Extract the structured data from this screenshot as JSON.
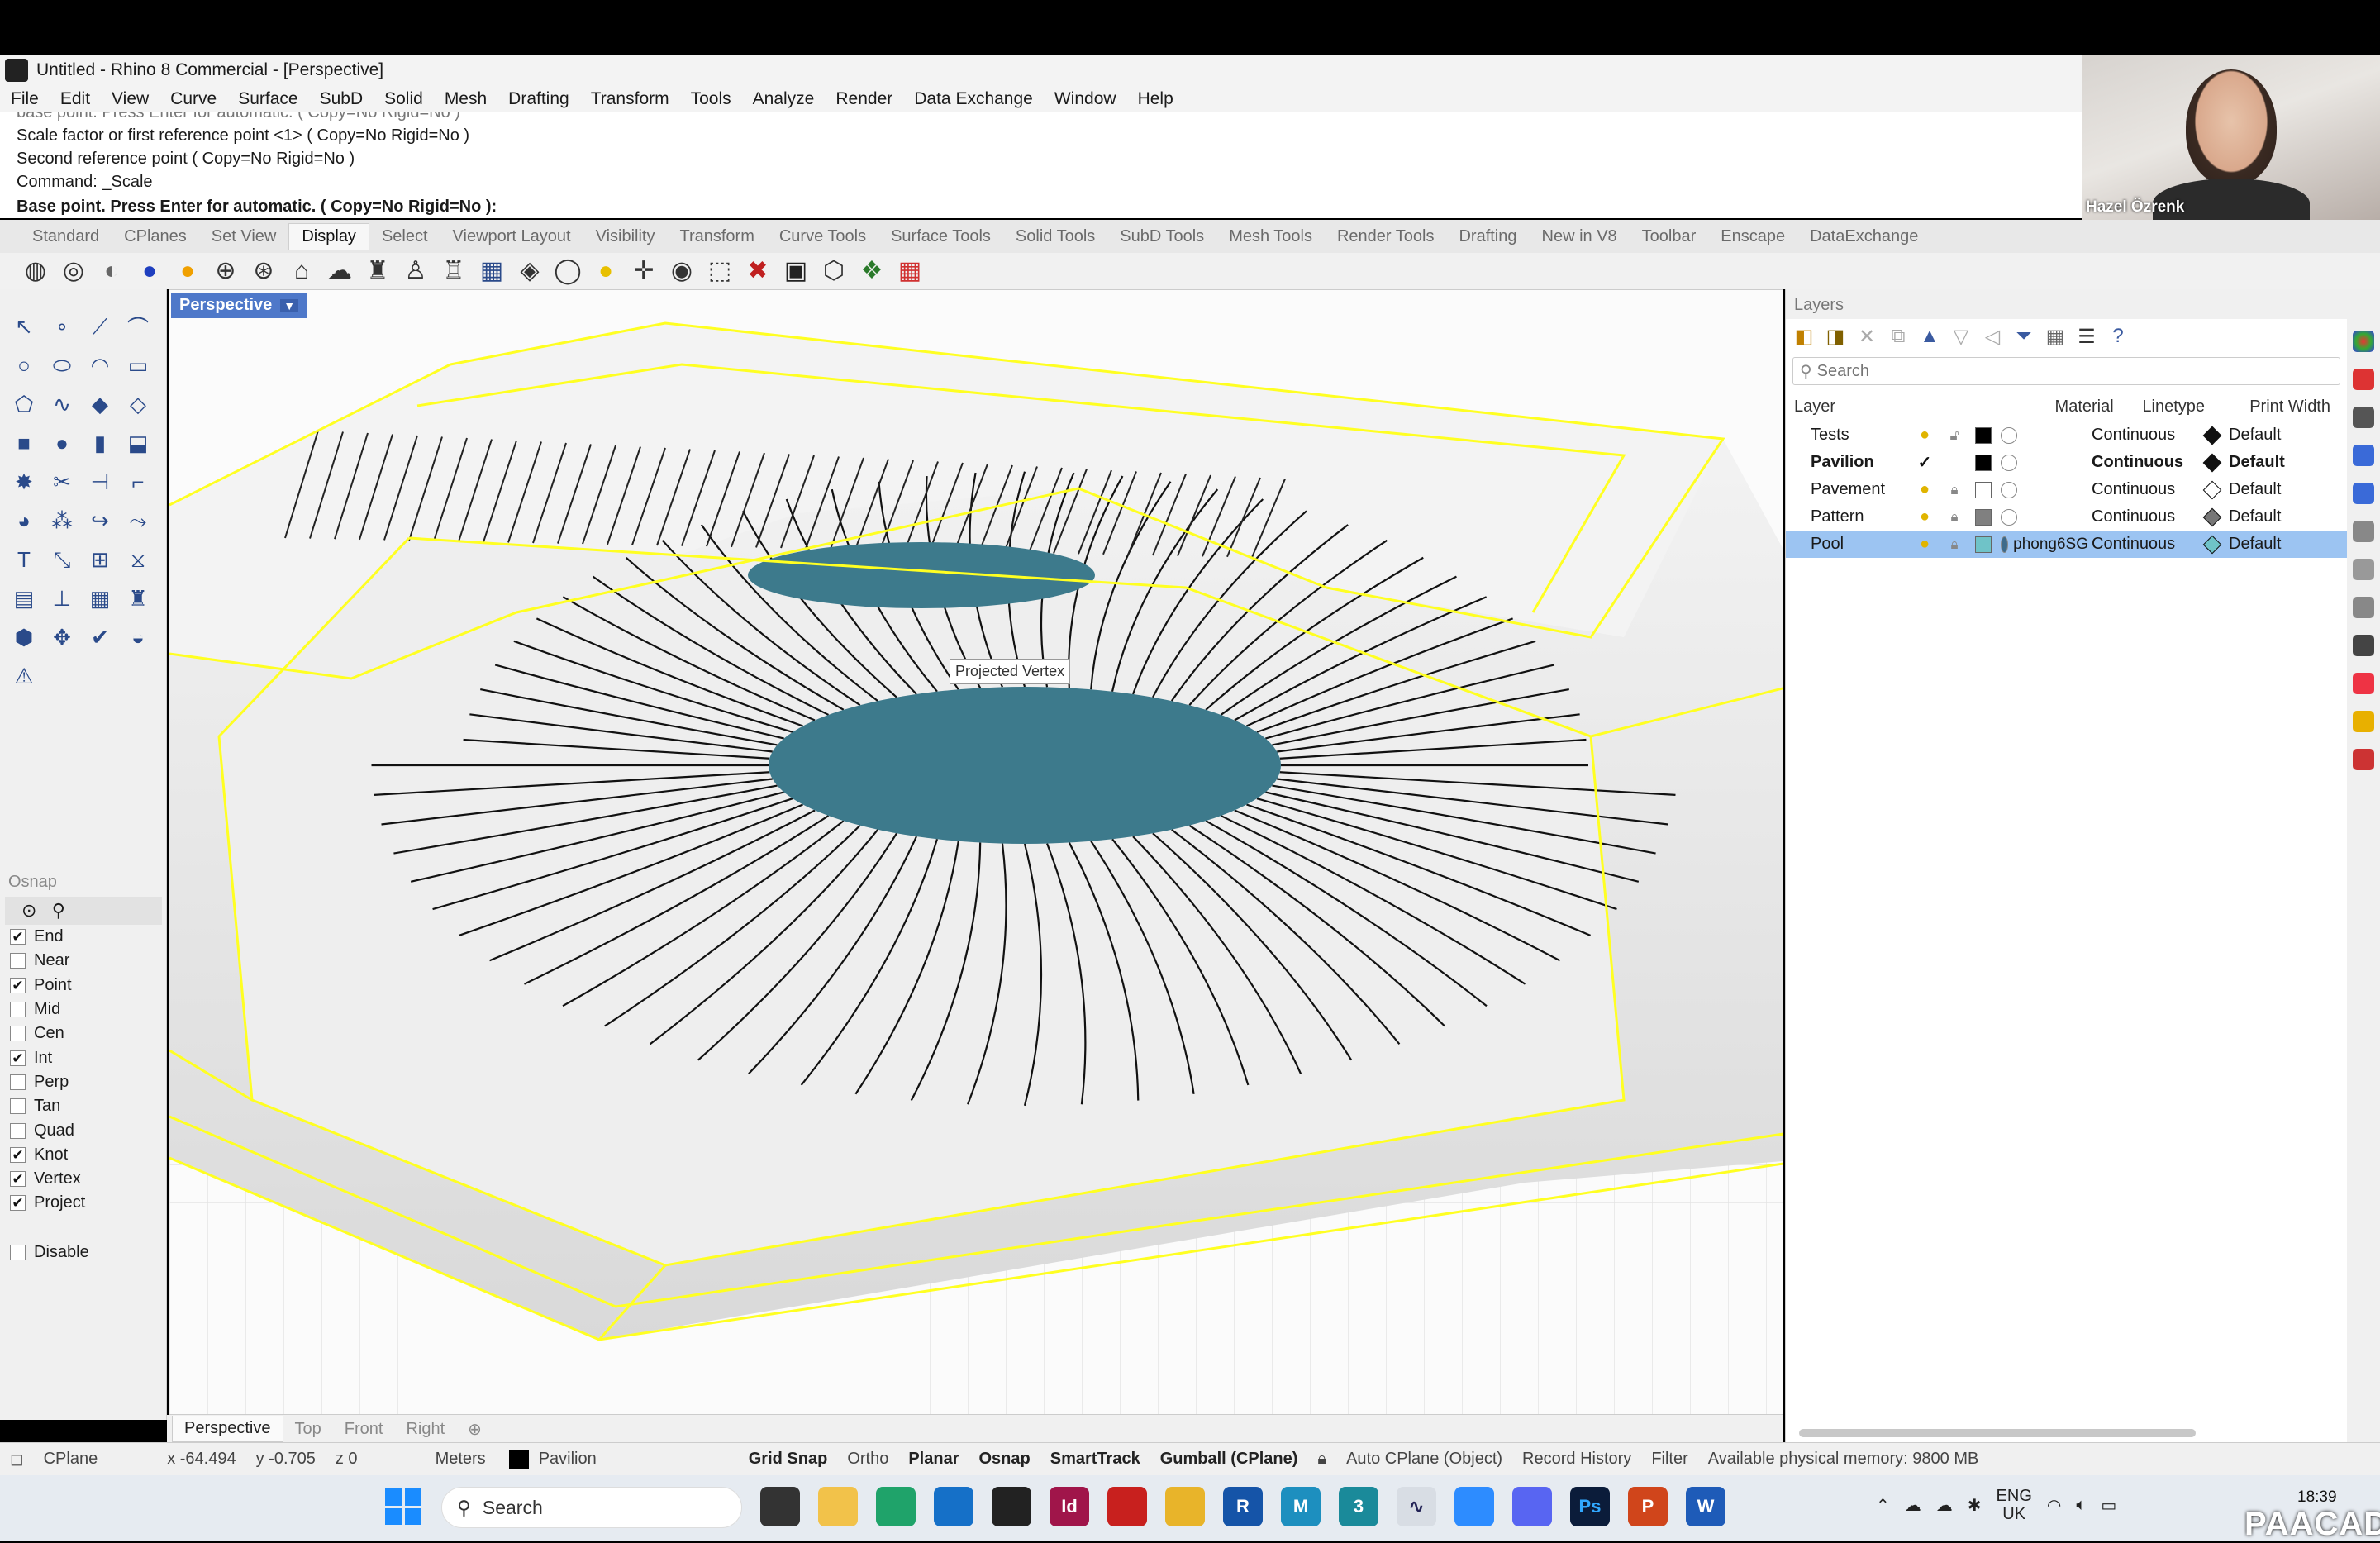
{
  "window": {
    "title": "Untitled - Rhino 8 Commercial - [Perspective]"
  },
  "menu": [
    "File",
    "Edit",
    "View",
    "Curve",
    "Surface",
    "SubD",
    "Solid",
    "Mesh",
    "Drafting",
    "Transform",
    "Tools",
    "Analyze",
    "Render",
    "Data Exchange",
    "Window",
    "Help"
  ],
  "command_history": {
    "line0": "base point. Press Enter for automatic. ( Copy=No  Rigid=No )",
    "line1": "Scale factor or first reference point <1> ( Copy=No  Rigid=No )",
    "line2": "Second reference point ( Copy=No  Rigid=No )",
    "line3": "Command: _Scale",
    "prompt": "Base point. Press Enter for automatic. ( Copy=No  Rigid=No ):"
  },
  "video": {
    "name": "Hazel Özrenk"
  },
  "toolbar_tabs": [
    "Standard",
    "CPlanes",
    "Set View",
    "Display",
    "Select",
    "Viewport Layout",
    "Visibility",
    "Transform",
    "Curve Tools",
    "Surface Tools",
    "Solid Tools",
    "SubD Tools",
    "Mesh Tools",
    "Render Tools",
    "Drafting",
    "New in V8",
    "Toolbar",
    "Enscape",
    "DataExchange"
  ],
  "active_tab": "Display",
  "viewport": {
    "name": "Perspective",
    "tooltip": "Projected Vertex"
  },
  "viewport_tabs": [
    "Perspective",
    "Top",
    "Front",
    "Right"
  ],
  "osnap": {
    "title": "Osnap",
    "items": [
      {
        "label": "End",
        "checked": true
      },
      {
        "label": "Near",
        "checked": false
      },
      {
        "label": "Point",
        "checked": true
      },
      {
        "label": "Mid",
        "checked": false
      },
      {
        "label": "Cen",
        "checked": false
      },
      {
        "label": "Int",
        "checked": true
      },
      {
        "label": "Perp",
        "checked": false
      },
      {
        "label": "Tan",
        "checked": false
      },
      {
        "label": "Quad",
        "checked": false
      },
      {
        "label": "Knot",
        "checked": true
      },
      {
        "label": "Vertex",
        "checked": true
      },
      {
        "label": "Project",
        "checked": true
      }
    ],
    "disable": "Disable"
  },
  "layers": {
    "title": "Layers",
    "search_placeholder": "Search",
    "columns": {
      "layer": "Layer",
      "material": "Material",
      "linetype": "Linetype",
      "print_width": "Print Width"
    },
    "rows": [
      {
        "name": "Tests",
        "color": "#000000",
        "material": "",
        "linetype": "Continuous",
        "print_width": "Default"
      },
      {
        "name": "Pavilion",
        "color": "#000000",
        "material": "",
        "linetype": "Continuous",
        "print_width": "Default",
        "current": true
      },
      {
        "name": "Pavement",
        "color": "#ffffff",
        "material": "",
        "linetype": "Continuous",
        "print_width": "Default"
      },
      {
        "name": "Pattern",
        "color": "#808080",
        "material": "",
        "linetype": "Continuous",
        "print_width": "Default"
      },
      {
        "name": "Pool",
        "color": "#6fc3c8",
        "material": "phong6SG",
        "linetype": "Continuous",
        "print_width": "Default",
        "selected": true
      }
    ]
  },
  "status": {
    "cplane": "CPlane",
    "x": "x -64.494",
    "y": "y -0.705",
    "z": "z 0",
    "units": "Meters",
    "layer": "Pavilion",
    "grid_snap": "Grid Snap",
    "ortho": "Ortho",
    "planar": "Planar",
    "osnap": "Osnap",
    "smarttrack": "SmartTrack",
    "gumball": "Gumball (CPlane)",
    "auto_cplane": "Auto CPlane (Object)",
    "record_history": "Record History",
    "filter": "Filter",
    "memory": "Available physical memory: 9800 MB"
  },
  "taskbar": {
    "search": "Search",
    "lang1": "ENG",
    "lang2": "UK",
    "time": "18:39"
  },
  "watermark": "PAACADEMY",
  "colors": {
    "accent": "#4e78c9",
    "selection": "#9cc4f2",
    "highlight": "#ffff22",
    "pool": "#3d7a8c"
  }
}
